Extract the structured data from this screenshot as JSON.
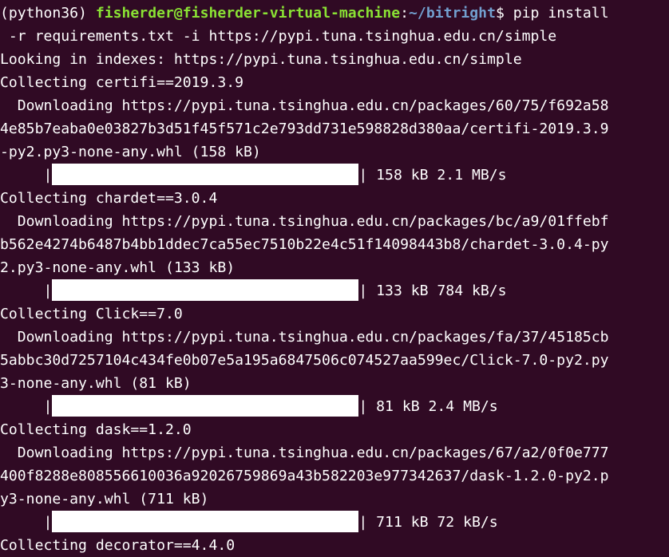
{
  "prompt": {
    "env": "(python36)",
    "user_host": "fisherder@fisherder-virtual-machine",
    "colon": ":",
    "path": "~/bitright",
    "dollar": "$ ",
    "command_part1": "pip install",
    "command_part2": " -r requirements.txt -i https://pypi.tuna.tsinghua.edu.cn/simple"
  },
  "index_line": "Looking in indexes: https://pypi.tuna.tsinghua.edu.cn/simple",
  "packages": [
    {
      "collecting": "Collecting certifi==2019.3.9",
      "dl1": "  Downloading https://pypi.tuna.tsinghua.edu.cn/packages/60/75/f692a58",
      "dl2": "4e85b7eaba0e03827b3d51f45f571c2e793dd731e598828d380aa/certifi-2019.3.9",
      "dl3": "-py2.py3-none-any.whl (158 kB)",
      "bar_prefix": "     |",
      "bar_suffix": "| 158 kB 2.1 MB/s",
      "progress": 1.0
    },
    {
      "collecting": "Collecting chardet==3.0.4",
      "dl1": "  Downloading https://pypi.tuna.tsinghua.edu.cn/packages/bc/a9/01ffebf",
      "dl2": "b562e4274b6487b4bb1ddec7ca55ec7510b22e4c51f14098443b8/chardet-3.0.4-py",
      "dl3": "2.py3-none-any.whl (133 kB)",
      "bar_prefix": "     |",
      "bar_suffix": "| 133 kB 784 kB/s",
      "progress": 1.0
    },
    {
      "collecting": "Collecting Click==7.0",
      "dl1": "  Downloading https://pypi.tuna.tsinghua.edu.cn/packages/fa/37/45185cb",
      "dl2": "5abbc30d7257104c434fe0b07e5a195a6847506c074527aa599ec/Click-7.0-py2.py",
      "dl3": "3-none-any.whl (81 kB)",
      "bar_prefix": "     |",
      "bar_suffix": "| 81 kB 2.4 MB/s",
      "progress": 1.0
    },
    {
      "collecting": "Collecting dask==1.2.0",
      "dl1": "  Downloading https://pypi.tuna.tsinghua.edu.cn/packages/67/a2/0f0e777",
      "dl2": "400f8288e808556610036a92026759869a43b582203e977342637/dask-1.2.0-py2.p",
      "dl3": "y3-none-any.whl (711 kB)",
      "bar_prefix": "     |",
      "bar_suffix": "| 711 kB 72 kB/s",
      "progress": 1.0
    }
  ],
  "last_line": "Collecting decorator==4.4.0",
  "colors": {
    "background": "#300a24",
    "text": "#ffffff",
    "user_host": "#8ae234",
    "path": "#729fcf"
  }
}
